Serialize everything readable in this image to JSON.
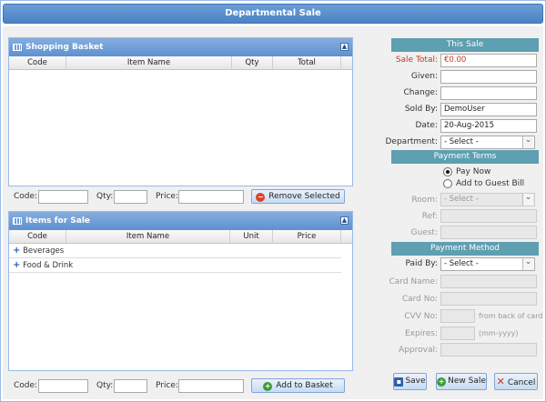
{
  "window": {
    "title": "Departmental Sale"
  },
  "basket": {
    "title": "Shopping Basket",
    "columns": [
      "Code",
      "Item Name",
      "Qty",
      "Total"
    ],
    "footer": {
      "code_label": "Code:",
      "qty_label": "Qty:",
      "price_label": "Price:",
      "button": "Remove Selected"
    }
  },
  "items": {
    "title": "Items for Sale",
    "columns": [
      "Code",
      "Item Name",
      "Unit",
      "Price"
    ],
    "rows": [
      {
        "label": "Beverages"
      },
      {
        "label": "Food & Drink"
      }
    ],
    "footer": {
      "code_label": "Code:",
      "qty_label": "Qty:",
      "price_label": "Price:",
      "button": "Add to Basket"
    }
  },
  "this_sale": {
    "title": "This Sale",
    "sale_total_label": "Sale Total:",
    "sale_total": "€0.00",
    "given_label": "Given:",
    "given": "",
    "change_label": "Change:",
    "change": "",
    "sold_by_label": "Sold By:",
    "sold_by": "DemoUser",
    "date_label": "Date:",
    "date": "20-Aug-2015",
    "department_label": "Department:",
    "department": "- Select -"
  },
  "payment_terms": {
    "title": "Payment Terms",
    "options": [
      "Pay Now",
      "Add to Guest Bill"
    ],
    "selected": "Pay Now",
    "room_label": "Room:",
    "room": "- Select -",
    "ref_label": "Ref:",
    "guest_label": "Guest:"
  },
  "payment_method": {
    "title": "Payment Method",
    "paid_by_label": "Paid By:",
    "paid_by": "- Select -",
    "card_name_label": "Card Name:",
    "card_no_label": "Card No:",
    "cvv_label": "CVV No:",
    "cvv_hint": "from back of card",
    "expires_label": "Expires:",
    "expires_hint": "(mm-yyyy)",
    "approval_label": "Approval:"
  },
  "actions": {
    "save": "Save",
    "new_sale": "New Sale",
    "cancel": "Cancel"
  },
  "colors": {
    "header_blue": "#5e91cf",
    "section_teal": "#5e9fb1",
    "total_red": "#c8361d"
  }
}
